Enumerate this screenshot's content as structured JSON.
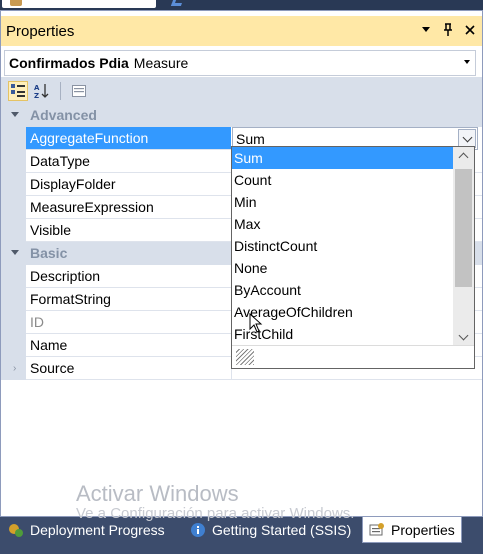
{
  "window": {
    "title": "Properties",
    "buttons": [
      "dropdown",
      "pin",
      "close"
    ]
  },
  "object_selector": {
    "name": "Confirmados Pdia",
    "type": "Measure"
  },
  "toolbar": {
    "tools": [
      "categorized-icon",
      "alphabetical-icon",
      "property-pages-icon"
    ]
  },
  "properties": {
    "advanced_label": "Advanced",
    "basic_label": "Basic",
    "rows": {
      "aggregate_function": "AggregateFunction",
      "data_type": "DataType",
      "display_folder": "DisplayFolder",
      "measure_expression": "MeasureExpression",
      "visible": "Visible",
      "description": "Description",
      "format_string": "FormatString",
      "id": "ID",
      "name": "Name",
      "source": "Source"
    },
    "aggregate_value": "Sum"
  },
  "dropdown": {
    "selected": "Sum",
    "options": [
      "Sum",
      "Count",
      "Min",
      "Max",
      "DistinctCount",
      "None",
      "ByAccount",
      "AverageOfChildren",
      "FirstChild"
    ]
  },
  "watermark": {
    "title": "Activar Windows",
    "subtitle": "Ve a Configuración para activar Windows."
  },
  "bottom_tabs": {
    "deployment": "Deployment Progress",
    "getting_started": "Getting Started (SSIS)",
    "properties": "Properties"
  },
  "colors": {
    "title_bar": "#ffe8a6",
    "selection": "#3399ff",
    "chrome": "#d8dfea",
    "background": "#2b3b5a"
  }
}
